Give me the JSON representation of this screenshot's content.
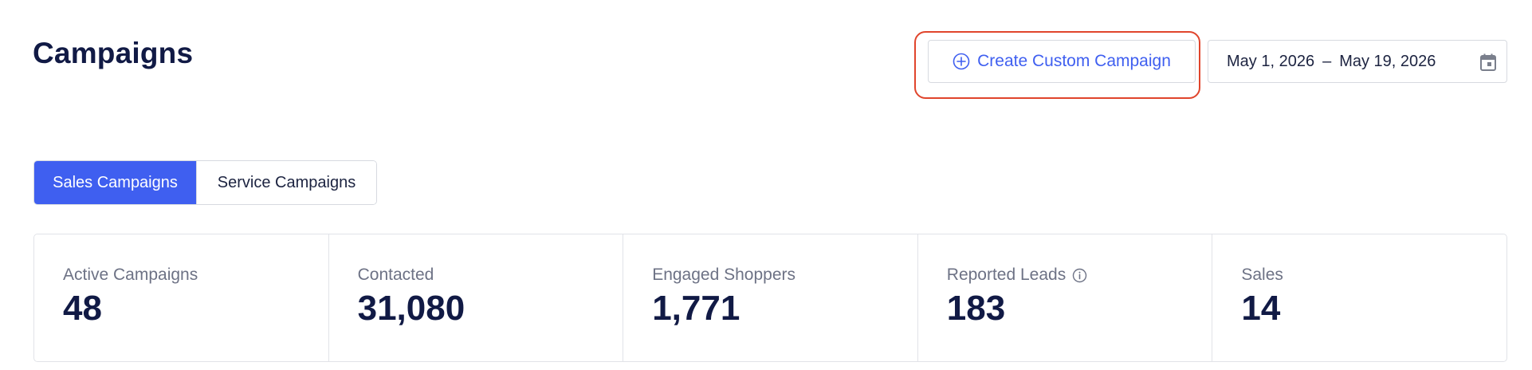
{
  "page": {
    "title": "Campaigns"
  },
  "header": {
    "create_button_label": "Create Custom Campaign",
    "create_button_icon": "plus-circle-icon",
    "date_range": {
      "start": "May 1, 2026",
      "separator": "–",
      "end": "May 19, 2026",
      "icon": "calendar-icon"
    }
  },
  "tabs": [
    {
      "label": "Sales Campaigns",
      "active": true
    },
    {
      "label": "Service Campaigns",
      "active": false
    }
  ],
  "stats": [
    {
      "label": "Active Campaigns",
      "value": "48"
    },
    {
      "label": "Contacted",
      "value": "31,080"
    },
    {
      "label": "Engaged Shoppers",
      "value": "1,771"
    },
    {
      "label": "Reported Leads",
      "value": "183",
      "icon": "info-icon"
    },
    {
      "label": "Sales",
      "value": "14"
    }
  ],
  "colors": {
    "accent": "#3f5ff0",
    "title": "#111a45",
    "highlight": "#e0452c",
    "muted_text": "#6d7285"
  }
}
